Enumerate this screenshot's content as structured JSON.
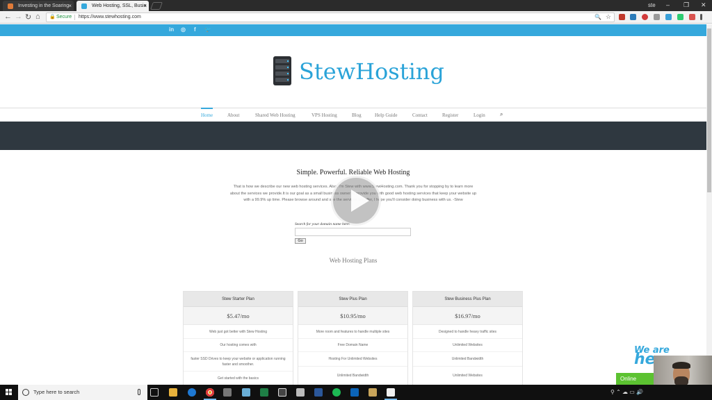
{
  "browser": {
    "tabs": [
      {
        "label": "Investing in the Soaring",
        "active": false,
        "close": "×"
      },
      {
        "label": "Web Hosting, SSL, Busin",
        "active": true,
        "close": "×"
      }
    ],
    "profile": "ste",
    "window_controls": {
      "minimize": "–",
      "restore": "❐",
      "close": "✕"
    },
    "back": "←",
    "forward": "→",
    "reload": "↻",
    "home": "⌂",
    "secure_label": "Secure",
    "url": "https://www.stewhosting.com"
  },
  "site": {
    "social_icons": [
      "in",
      "◎",
      "f",
      "🐦"
    ],
    "logo_text": "StewHosting",
    "nav": [
      {
        "label": "Home",
        "active": true
      },
      {
        "label": "About",
        "active": false
      },
      {
        "label": "Shared Web Hosting",
        "active": false
      },
      {
        "label": "VPS Hosting",
        "active": false
      },
      {
        "label": "Blog",
        "active": false
      },
      {
        "label": "Help Guide",
        "active": false
      },
      {
        "label": "Contact",
        "active": false
      },
      {
        "label": "Register",
        "active": false
      },
      {
        "label": "Login",
        "active": false
      }
    ],
    "tagline": "Simple. Powerful. Reliable Web Hosting",
    "intro": "That is how we describe our new web hosting services. Also, I'm Stew with www.StewHosting.com. Thank you for stopping by to learn more about the services we provide.It is our goal as a small business owner to provide you with good web hosting services that keep your website up with a 99.9% up time. Please browse around and see the services we offer, I hope you'll consider doing business with us. -Stew",
    "domain_label": "Search for your domain name here:",
    "go_label": "Go",
    "plans_heading": "Web Hosting Plans",
    "plans": [
      {
        "name": "Stew Starter Plan",
        "price": "$5.47/mo",
        "features": [
          "Web just got better with Stew Hosting",
          "Our hosting comes with",
          "faster SSD Drives to keep your website or application running faster and smoother.",
          "Get started with the basics"
        ]
      },
      {
        "name": "Stew Plus Plan",
        "price": "$10.95/mo",
        "features": [
          "More room and features to handle multiple sites",
          "Free Domain Name",
          "Hosting For Unlimited Websites",
          "Unlimited Bandwidth"
        ]
      },
      {
        "name": "Stew Business Plus Plan",
        "price": "$16.97/mo",
        "features": [
          "Designed to handle heavy traffic sites",
          "Unlimited Websites",
          "Unlimited Bandwidth",
          "Unlimited Websites"
        ]
      }
    ]
  },
  "overlay": {
    "online_label": "Online",
    "weare_line1": "We are",
    "weare_line2": "he"
  },
  "taskbar": {
    "search_placeholder": "Type here to search"
  },
  "colors": {
    "accent": "#35a8dc",
    "dark_band": "#2f3840",
    "online": "#5cc231"
  }
}
